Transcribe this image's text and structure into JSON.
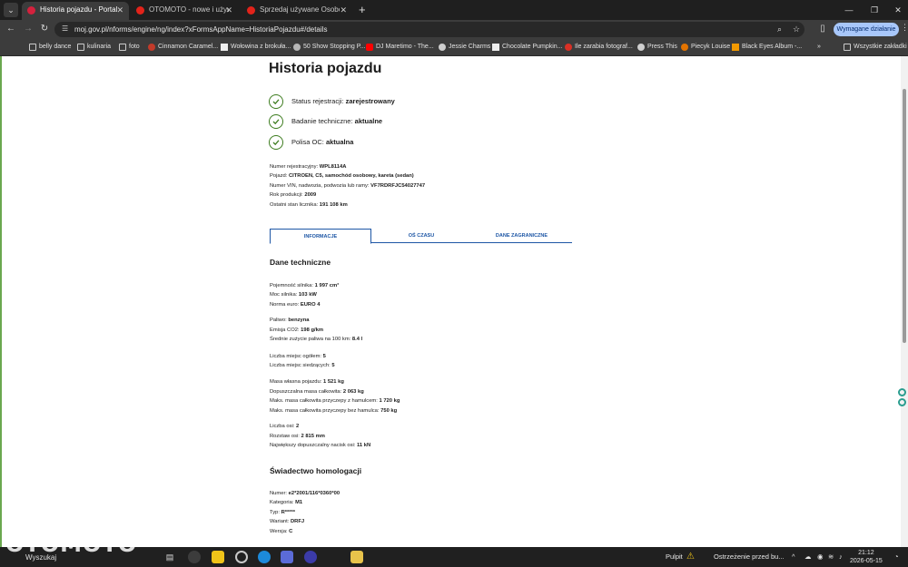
{
  "browser": {
    "tabs": [
      {
        "title": "Historia pojazdu - Portal gov.pl",
        "close": "✕"
      },
      {
        "title": "OTOMOTO - nowe i używane sa",
        "close": "✕"
      },
      {
        "title": "Sprzedaj używane Osobowe | O",
        "close": "✕"
      }
    ],
    "new_tab": "+",
    "url": "moj.gov.pl/nforms/engine/ng/index?xFormsAppName=HistoriaPojazdu#/details",
    "update_button": "Wymagane działanie",
    "bookmarks": [
      "belly dance",
      "kulinaria",
      "foto",
      "Cinnamon Caramel...",
      "Wołowina z brokuła...",
      "50 Show Stopping P...",
      "DJ Maretimo - The...",
      "Jessie Charms",
      "Chocolate Pumpkin...",
      "Ile zarabia fotograf...",
      "Press This",
      "Piecyk Louise",
      "Black Eyes Album -..."
    ],
    "bookmarks_more": "»",
    "all_bookmarks": "Wszystkie zakładki"
  },
  "page": {
    "title": "Historia pojazdu",
    "statuses": [
      {
        "label": "Status rejestracji:",
        "value": "zarejestrowany"
      },
      {
        "label": "Badanie techniczne:",
        "value": "aktualne"
      },
      {
        "label": "Polisa OC:",
        "value": "aktualna"
      }
    ],
    "vehicle": [
      {
        "label": "Numer rejestracyjny:",
        "value": "WPL8114A"
      },
      {
        "label": "Pojazd:",
        "value": "CITROEN, C5, samochód osobowy, kareta (sedan)"
      },
      {
        "label": "Numer VIN, nadwozia, podwozia lub ramy:",
        "value": "VF7RDRFJC54027747"
      },
      {
        "label": "Rok produkcji:",
        "value": "2009"
      },
      {
        "label": "Ostatni stan licznika:",
        "value": "191 108 km"
      }
    ],
    "tabs": [
      "INFORMACJE",
      "OŚ CZASU",
      "DANE ZAGRANICZNE"
    ],
    "technical_title": "Dane techniczne",
    "technical": [
      {
        "label": "Pojemność silnika:",
        "value": "1 997 cm³"
      },
      {
        "label": "Moc silnika:",
        "value": "103 kW"
      },
      {
        "label": "Norma euro:",
        "value": "EURO 4"
      },
      {
        "label": "Paliwo:",
        "value": "benzyna"
      },
      {
        "label": "Emisja CO2:",
        "value": "198 g/km"
      },
      {
        "label": "Średnie zużycie paliwa na 100 km:",
        "value": "8.4 l"
      },
      {
        "label": "Liczba miejsc ogółem:",
        "value": "5"
      },
      {
        "label": "Liczba miejsc siedzących:",
        "value": "5"
      },
      {
        "label": "Masa własna pojazdu:",
        "value": "1 521 kg"
      },
      {
        "label": "Dopuszczalna masa całkowita:",
        "value": "2 063 kg"
      },
      {
        "label": "Maks. masa całkowita przyczepy z hamulcem:",
        "value": "1 720 kg"
      },
      {
        "label": "Maks. masa całkowita przyczepy bez hamulca:",
        "value": "750 kg"
      },
      {
        "label": "Liczba osi:",
        "value": "2"
      },
      {
        "label": "Rozstaw osi:",
        "value": "2 815 mm"
      },
      {
        "label": "Największy dopuszczalny nacisk osi:",
        "value": "11 kN"
      }
    ],
    "homologation_title": "Świadectwo homologacji",
    "homologation": [
      {
        "label": "Numer:",
        "value": "e2*2001/116*0360*00"
      },
      {
        "label": "Kategoria:",
        "value": "M1"
      },
      {
        "label": "Typ:",
        "value": "R*****"
      },
      {
        "label": "Wariant:",
        "value": "DRFJ"
      },
      {
        "label": "Wersja:",
        "value": "C"
      }
    ]
  },
  "taskbar": {
    "watermark": "OTOMOTO",
    "search": "Wyszukaj",
    "desktop": "Pulpit",
    "notification": "Ostrzeżenie przed bu...",
    "time": "21:12",
    "date": "2026-05-15"
  },
  "colors": {
    "accent_blue": "#1d56a5",
    "check_green": "#3d7c1f",
    "update_button": "#a8c7fa"
  }
}
